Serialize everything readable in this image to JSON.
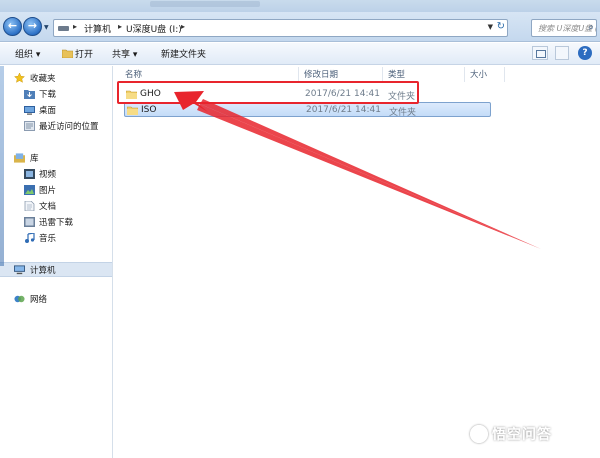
{
  "address_bar": {
    "crumbs": [
      "计算机",
      "U深度U盘 (I:)"
    ],
    "search_placeholder": "搜索 U深度U盘 (I:)"
  },
  "toolbar": {
    "organize": "组织 ▾",
    "open": "打开",
    "share": "共享 ▾",
    "new_folder": "新建文件夹"
  },
  "nav": {
    "favorites": "收藏夹",
    "downloads": "下载",
    "desktop": "桌面",
    "recent": "最近访问的位置",
    "libraries": "库",
    "videos": "视频",
    "pictures": "图片",
    "documents": "文档",
    "thunder": "迅雷下载",
    "music": "音乐",
    "computer": "计算机",
    "network": "网络"
  },
  "columns": {
    "name": "名称",
    "modified": "修改日期",
    "type": "类型",
    "size": "大小"
  },
  "files": [
    {
      "name": "GHO",
      "modified": "2017/6/21 14:41",
      "type": "文件夹",
      "size": ""
    },
    {
      "name": "ISO",
      "modified": "2017/6/21 14:41",
      "type": "文件夹",
      "size": ""
    }
  ],
  "annotation": {
    "color": "#e8252d"
  },
  "watermark": {
    "text": "悟空问答"
  },
  "icons": {
    "back": "back-arrow-icon",
    "forward": "forward-arrow-icon",
    "folder": "folder-icon",
    "star": "star-icon",
    "computer": "computer-icon",
    "network": "network-icon"
  }
}
